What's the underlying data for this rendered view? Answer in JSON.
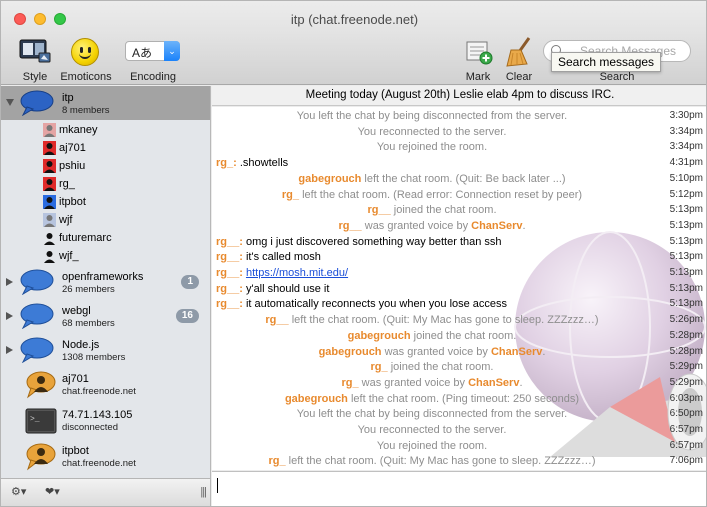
{
  "window": {
    "title": "itp (chat.freenode.net)"
  },
  "toolbar": {
    "style": "Style",
    "emoticons": "Emoticons",
    "encoding": "Encoding",
    "encoding_value": "Aあ",
    "mark": "Mark",
    "clear": "Clear",
    "search_label": "Search",
    "search_placeholder": "Search Messages",
    "tooltip": "Search messages"
  },
  "sidebar": {
    "channels": [
      {
        "name": "itp",
        "sub": "8 members",
        "badge": "",
        "expanded": true,
        "selected": true
      },
      {
        "name": "openframeworks",
        "sub": "26 members",
        "badge": "1"
      },
      {
        "name": "webgl",
        "sub": "68 members",
        "badge": "16"
      },
      {
        "name": "Node.js",
        "sub": "1308 members",
        "badge": ""
      }
    ],
    "members": [
      {
        "name": "mkaney",
        "icon": "away-user-icon"
      },
      {
        "name": "aj701",
        "icon": "op-user-icon"
      },
      {
        "name": "pshiu",
        "icon": "op-user-icon"
      },
      {
        "name": "rg_",
        "icon": "op-user-icon"
      },
      {
        "name": "itpbot",
        "icon": "voice-user-icon"
      },
      {
        "name": "wjf",
        "icon": "away-user-icon"
      },
      {
        "name": "futuremarc",
        "icon": "user-icon"
      },
      {
        "name": "wjf_",
        "icon": "user-icon"
      }
    ],
    "dms": [
      {
        "name": "aj701",
        "sub": "chat.freenode.net",
        "icon": "private-chat-icon"
      },
      {
        "name": "74.71.143.105",
        "sub": "disconnected",
        "icon": "console-icon"
      },
      {
        "name": "itpbot",
        "sub": "chat.freenode.net",
        "icon": "private-chat-icon"
      }
    ],
    "footer": {
      "gear": "⚙▾",
      "heart": "❤▾",
      "grip": "|||"
    }
  },
  "chat": {
    "topic": "Meeting today (August 20th) Leslie elab 4pm to discuss IRC.",
    "messages": [
      {
        "kind": "status",
        "nick": "",
        "text": "You left the chat by being disconnected from the server.",
        "time": "3:30pm"
      },
      {
        "kind": "status",
        "nick": "",
        "text": "You reconnected to the server.",
        "time": "3:34pm"
      },
      {
        "kind": "status",
        "nick": "",
        "text": "You rejoined the room.",
        "time": "3:34pm"
      },
      {
        "kind": "speak",
        "nick": "rg_:",
        "text": " .showtells",
        "time": "4:31pm"
      },
      {
        "kind": "status",
        "nick": "gabegrouch",
        "text": " left the chat room. (Quit: Be back later ...)",
        "time": "5:10pm"
      },
      {
        "kind": "status",
        "nick": "rg_",
        "text": " left the chat room. (Read error: Connection reset by peer)",
        "time": "5:12pm"
      },
      {
        "kind": "status",
        "nick": "rg__",
        "text": " joined the chat room.",
        "time": "5:13pm"
      },
      {
        "kind": "status",
        "nick": "rg__",
        "text": " was granted voice by ",
        "nick2": "ChanServ",
        "tail": ".",
        "time": "5:13pm"
      },
      {
        "kind": "speak",
        "nick": "rg__:",
        "text": " omg i just discovered something way better than ssh",
        "time": "5:13pm"
      },
      {
        "kind": "speak",
        "nick": "rg__:",
        "text": " it's called mosh",
        "time": "5:13pm"
      },
      {
        "kind": "speak",
        "nick": "rg__:",
        "text": " ",
        "link": "https://mosh.mit.edu/",
        "time": "5:13pm"
      },
      {
        "kind": "speak",
        "nick": "rg__:",
        "text": " y'all should use it",
        "time": "5:13pm"
      },
      {
        "kind": "speak",
        "nick": "rg__:",
        "text": " it automatically reconnects you when you lose access",
        "time": "5:13pm"
      },
      {
        "kind": "status",
        "nick": "rg__",
        "text": " left the chat room. (Quit: My Mac has gone to sleep. ZZZzzz…)",
        "time": "5:26pm"
      },
      {
        "kind": "status",
        "nick": "gabegrouch",
        "text": " joined the chat room.",
        "time": "5:28pm"
      },
      {
        "kind": "status",
        "nick": "gabegrouch",
        "text": " was granted voice by ",
        "nick2": "ChanServ",
        "tail": ".",
        "time": "5:28pm"
      },
      {
        "kind": "status",
        "nick": "rg_",
        "text": " joined the chat room.",
        "time": "5:29pm"
      },
      {
        "kind": "status",
        "nick": "rg_",
        "text": " was granted voice by ",
        "nick2": "ChanServ",
        "tail": ".",
        "time": "5:29pm"
      },
      {
        "kind": "status",
        "nick": "gabegrouch",
        "text": " left the chat room. (Ping timeout: 250 seconds)",
        "time": "6:03pm"
      },
      {
        "kind": "status",
        "nick": "",
        "text": "You left the chat by being disconnected from the server.",
        "time": "6:50pm"
      },
      {
        "kind": "status",
        "nick": "",
        "text": "You reconnected to the server.",
        "time": "6:57pm"
      },
      {
        "kind": "status",
        "nick": "",
        "text": "You rejoined the room.",
        "time": "6:57pm"
      },
      {
        "kind": "status",
        "nick": "rg_",
        "text": " left the chat room. (Quit: My Mac has gone to sleep. ZZZzzz…)",
        "time": "7:06pm"
      }
    ]
  }
}
